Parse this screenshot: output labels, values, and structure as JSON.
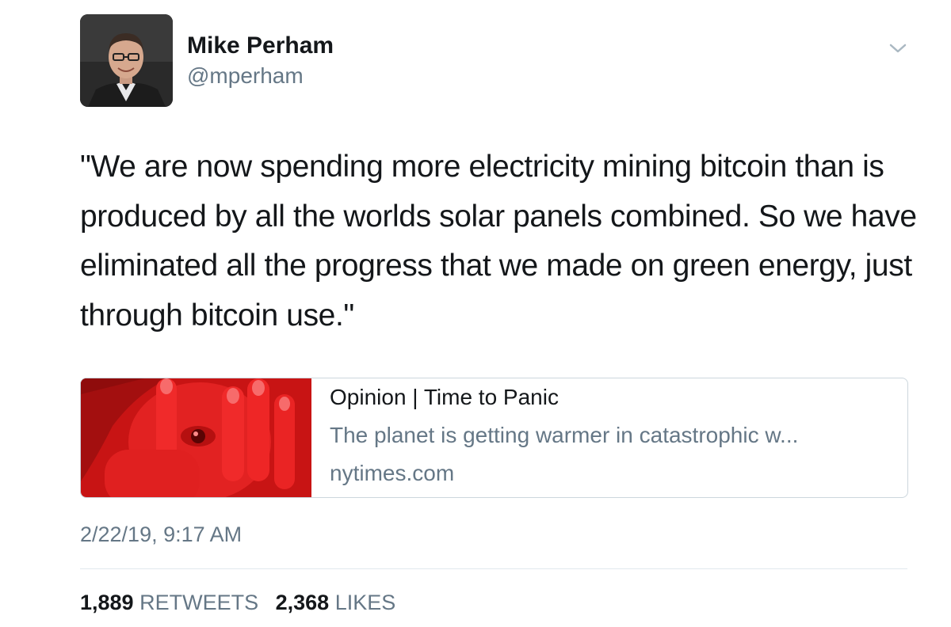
{
  "author": {
    "name": "Mike Perham",
    "handle": "@mperham"
  },
  "icons": {
    "menu": "chevron-down-icon"
  },
  "tweet": {
    "text": "\"We are now spending more electricity mining bitcoin than is produced by all the worlds solar panels combined. So we have eliminated all the progress that we made on green energy, just through bitcoin use.\"",
    "timestamp": "2/22/19, 9:17 AM"
  },
  "card": {
    "title": "Opinion | Time to Panic",
    "description": "The planet is getting warmer in catastrophic w...",
    "domain": "nytimes.com"
  },
  "stats": {
    "retweets_count": "1,889",
    "retweets_label": "RETWEETS",
    "likes_count": "2,368",
    "likes_label": "LIKES"
  },
  "colors": {
    "text_primary": "#14171a",
    "text_secondary": "#657786",
    "border": "#ccd6dd",
    "card_image_red": "#d81b1b"
  }
}
